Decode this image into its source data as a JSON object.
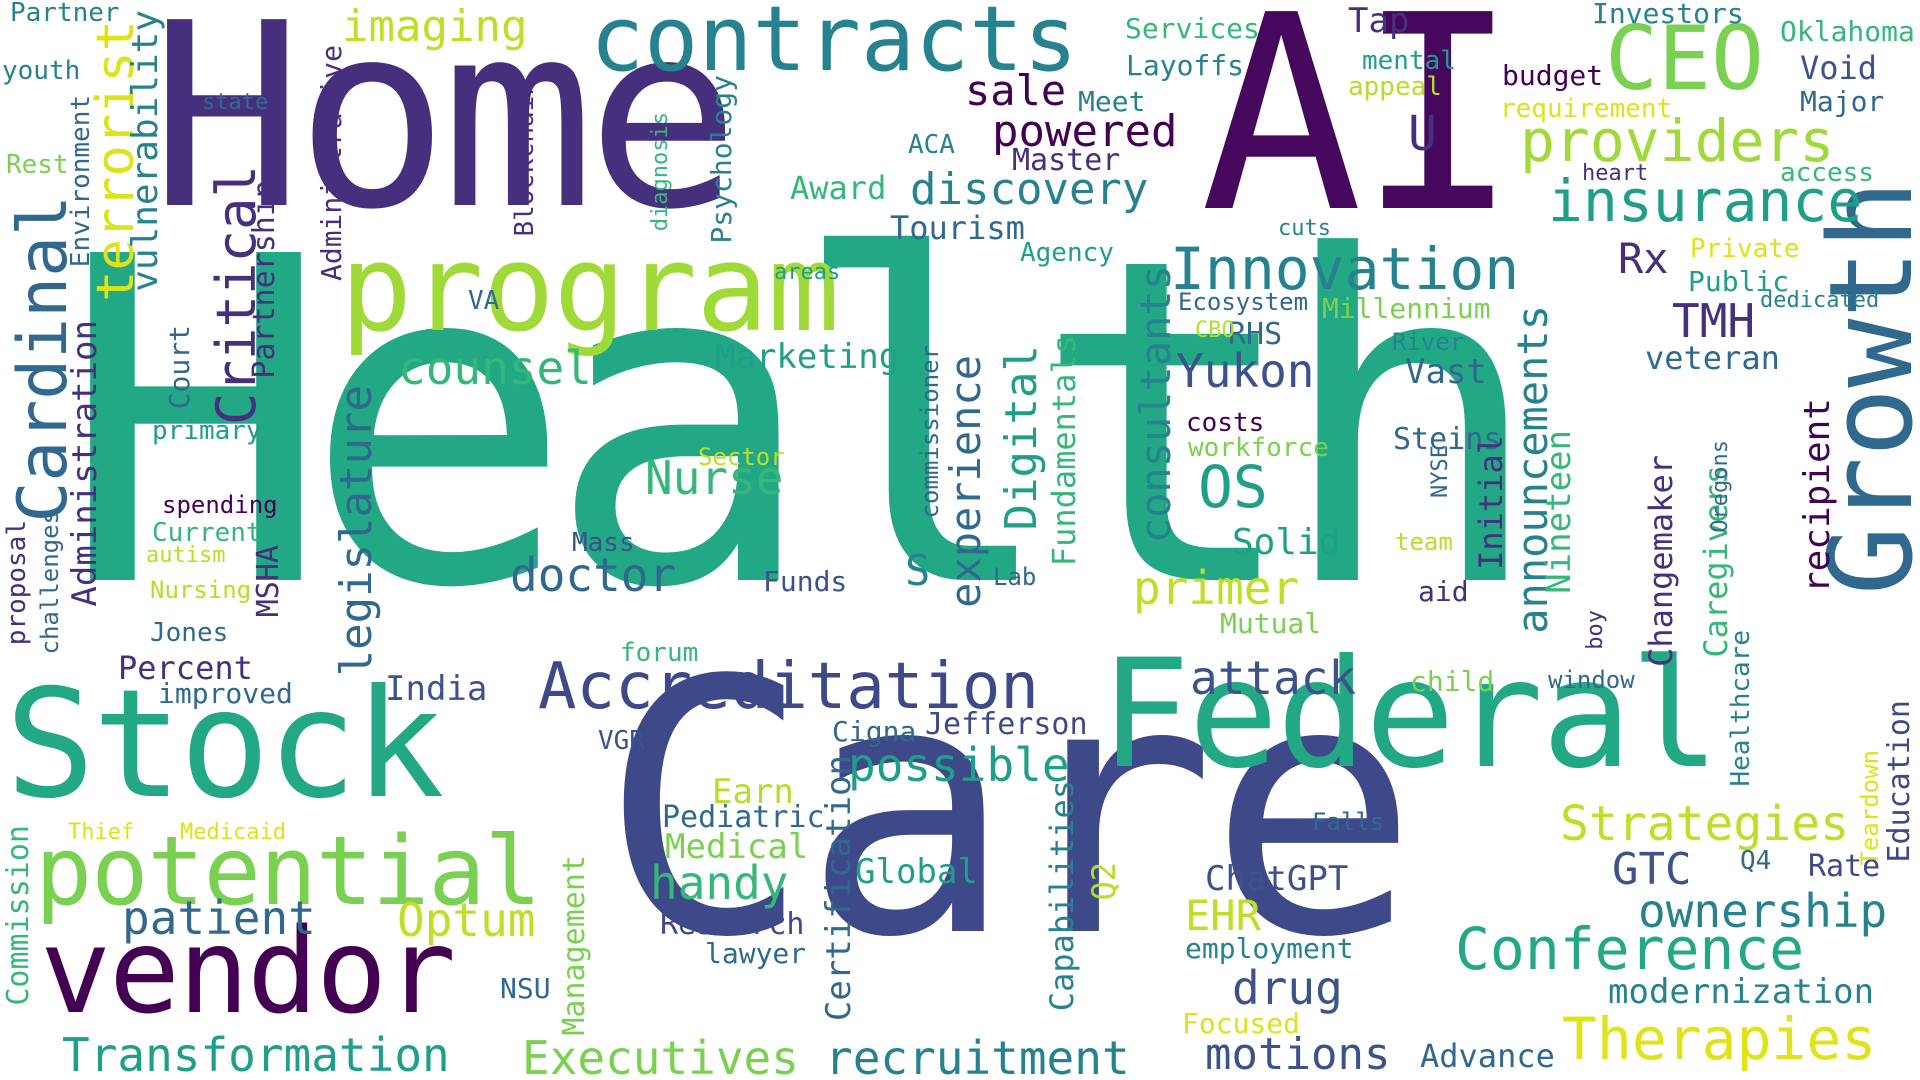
{
  "cloud": {
    "palette": {
      "deep_purple": "#46085c",
      "purple": "#46307d",
      "indigo": "#3e4989",
      "blue": "#31688e",
      "teal": "#26828e",
      "green_teal": "#1f9e89",
      "green": "#35b779",
      "lime": "#6ece58",
      "yellow_green": "#b5de2b",
      "yellow": "#e0e318"
    },
    "words": {
      "health": "Health",
      "care": "Care",
      "ai": "AI",
      "home": "Home",
      "growth": "Growth",
      "federal": "Federal",
      "stock": "Stock",
      "vendor": "vendor",
      "program": "program",
      "contracts": "contracts",
      "ceo": "CEO",
      "potential": "potential",
      "accreditation": "Accreditation",
      "conference": "Conference",
      "therapies": "Therapies",
      "providers": "providers",
      "insurance": "insurance",
      "innovation": "Innovation",
      "transformation": "Transformation",
      "executives": "Executives",
      "recruitment": "recruitment",
      "cardinal": "Cardinal",
      "terrorist": "terrorist",
      "critical": "Critical",
      "legislature": "legislature",
      "announcements": "announcements",
      "consultants": "consultants",
      "experience": "experience",
      "digital": "Digital",
      "patient": "patient",
      "strategies": "Strategies",
      "ownership": "ownership",
      "motions": "motions",
      "doctor": "doctor",
      "nurse": "Nurse",
      "attack": "attack",
      "possible": "possible",
      "counsel": "counsel",
      "discovery": "discovery",
      "powered": "powered",
      "yukon": "Yukon",
      "os": "OS",
      "primer": "primer",
      "handy": "handy",
      "optum": "Optum",
      "drug": "drug",
      "modernization": "modernization",
      "imaging": "imaging",
      "sale": "sale",
      "u": "U",
      "tmh": "TMH",
      "rx": "Rx",
      "gtc": "GTC",
      "ehr": "EHR",
      "chatgpt": "ChatGPT",
      "marketing": "Marketing",
      "tourism": "Tourism",
      "master": "Master",
      "award": "Award",
      "vulnerability": "vulnerability",
      "administration": "Administration",
      "fundamentals": "Fundamentals",
      "capabilities": "Capabilities",
      "certification": "Certification",
      "management": "Management",
      "changemaker": "Changemaker",
      "caregivers": "Caregivers",
      "initial": "Initial",
      "nineteen": "Nineteen",
      "recipient": "recipient",
      "education": "Education",
      "india": "India",
      "percent": "Percent",
      "improved": "improved",
      "jones": "Jones",
      "nursing": "Nursing",
      "autism": "autism",
      "current": "Current",
      "spending": "spending",
      "primary": "primary",
      "mass": "Mass",
      "funds": "Funds",
      "lab": "Lab",
      "forum": "forum",
      "vgr": "VGR",
      "earn": "Earn",
      "pediatric": "Pediatric",
      "medical": "Medical",
      "research": "Research",
      "lawyer": "lawyer",
      "nsu": "NSU",
      "global": "Global",
      "q2": "Q2",
      "cigna": "Cigna",
      "jefferson": "Jefferson",
      "employment": "employment",
      "focused": "Focused",
      "advance": "Advance",
      "solid": "Solid",
      "aid": "aid",
      "mutual": "Mutual",
      "child": "child",
      "window": "window",
      "team": "team",
      "steins": "Steins",
      "workforce": "workforce",
      "costs": "costs",
      "vast": "Vast",
      "rhs": "RHS",
      "cbo": "CBO",
      "river": "River",
      "millennium": "Millennium",
      "ecosystem": "Ecosystem",
      "veteran": "veteran",
      "public": "Public",
      "private": "Private",
      "dedicated": "dedicated",
      "access": "access",
      "heart": "heart",
      "cuts": "cuts",
      "major": "Major",
      "void": "Void",
      "oklahoma": "Oklahoma",
      "investors": "Investors",
      "requirement": "requirement",
      "budget": "budget",
      "tap": "Tap",
      "mental": "mental",
      "appeal": "appeal",
      "services": "Services",
      "layoffs": "Layoffs",
      "meet": "Meet",
      "aca": "ACA",
      "agency": "Agency",
      "va": "VA",
      "areas": "areas",
      "partner": "Partner",
      "youth": "youth",
      "rest": "Rest",
      "state": "state",
      "sector": "Sector",
      "s": "S",
      "rate": "Rate",
      "q4": "Q4",
      "falls": "Falls",
      "thief": "Thief",
      "medicaid": "Medicaid",
      "commission": "Commission",
      "proposal": "proposal",
      "challenges": "challenges",
      "msha": "MSHA",
      "court": "Court",
      "partnership": "Partnership",
      "environment": "Environment",
      "administrative": "Administrative",
      "blockchain": "Blockchain",
      "diagnosis": "diagnosis",
      "psychology": "Psychology",
      "commissioner": "commissioner",
      "nyse": "NYSE",
      "oregons": "Oregons",
      "boy": "boy",
      "healthcare": "Healthcare",
      "teardown": "Teardown"
    }
  }
}
